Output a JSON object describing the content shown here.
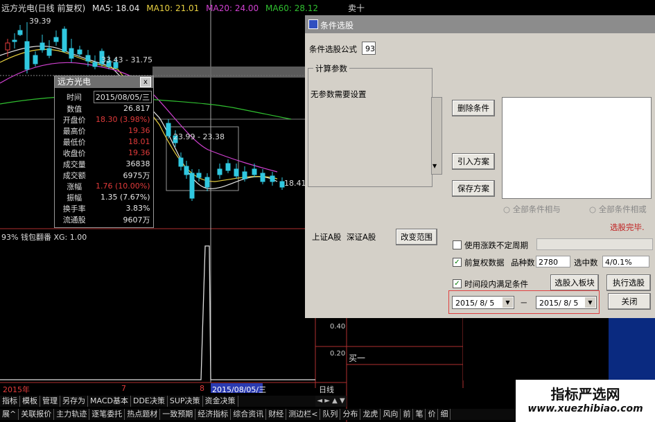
{
  "chart_header": {
    "title": "远方光电(日线 前复权)",
    "ma5": "MA5: 18.04",
    "ma10": "MA10: 21.01",
    "ma20": "MA20: 24.00",
    "ma60": "MA60: 28.12",
    "right_cut": "卖十"
  },
  "price_labels": {
    "high": "39.39",
    "range1": "33.43 - 31.75",
    "range2": "23.99 - 23.38",
    "right": "18.41"
  },
  "indicator": {
    "header": "93% 钱包翻番  XG: 1.00",
    "ticks": [
      "0.40",
      "0.20"
    ],
    "buy_label": "买一"
  },
  "x_axis": {
    "year": "2015年",
    "m7": "7",
    "m8": "8",
    "cursor_date": "2015/08/05/三",
    "period": "日线"
  },
  "info_popup": {
    "title": "远方光电",
    "close_glyph": "x",
    "rows": [
      {
        "k": "时间",
        "v": "2015/08/05/三",
        "c": "#e6e6e6"
      },
      {
        "k": "数值",
        "v": "26.817",
        "c": "#e6e6e6"
      },
      {
        "k": "开盘价",
        "v": "18.30 (3.98%)",
        "c": "#e23b3b"
      },
      {
        "k": "最高价",
        "v": "19.36",
        "c": "#e23b3b"
      },
      {
        "k": "最低价",
        "v": "18.01",
        "c": "#e23b3b"
      },
      {
        "k": "收盘价",
        "v": "19.36",
        "c": "#e23b3b"
      },
      {
        "k": "成交量",
        "v": "36838",
        "c": "#e6e6e6"
      },
      {
        "k": "成交额",
        "v": "6975万",
        "c": "#e6e6e6"
      },
      {
        "k": "涨幅",
        "v": "1.76 (10.00%)",
        "c": "#e23b3b"
      },
      {
        "k": "振幅",
        "v": "1.35 (7.67%)",
        "c": "#e6e6e6"
      },
      {
        "k": "换手率",
        "v": "3.83%",
        "c": "#e6e6e6"
      },
      {
        "k": "流通股",
        "v": "9607万",
        "c": "#e6e6e6"
      }
    ]
  },
  "dialog": {
    "title": "条件选股",
    "formula_label": "条件选股公式",
    "formula_value": "93",
    "group_label": "计算参数",
    "no_param": "无参数需要设置",
    "delete_btn": "删除条件",
    "import_btn": "引入方案",
    "save_btn": "保存方案",
    "radio_and": "全部条件相与",
    "radio_or": "全部条件相或",
    "done": "选股完毕.",
    "market1": "上证A股",
    "market2": "深证A股",
    "change_range": "改变范围",
    "cb_period": "使用涨跌不定周期",
    "cb_adjust": "前复权数据",
    "count_label": "品种数",
    "count_value": "2780",
    "selected_label": "选中数",
    "selected_value": "4/0.1%",
    "cb_range": "时间段内满足条件",
    "to_block": "选股入板块",
    "run": "执行选股",
    "date_from": "2015/ 8/ 5",
    "date_sep": "－",
    "date_to": "2015/ 8/ 5",
    "close": "关闭",
    "check_glyph": "✓",
    "arrow_glyph": "▼"
  },
  "tabs_row1": [
    "指标",
    "模板",
    "管理",
    "另存为",
    "MACD基本",
    "DDE决策",
    "SUP决策",
    "资金决策"
  ],
  "tabs_row2": [
    "展^",
    "关联报价",
    "主力轨迹",
    "逐笔委托",
    "热点题材",
    "一致预期",
    "经济指标",
    "综合资讯",
    "财经",
    "测边栏<",
    "队列",
    "分布",
    "龙虎",
    "风向",
    "前",
    "笔",
    "价",
    "细"
  ],
  "watermark": {
    "line1": "指标严选网",
    "line2": "www.xuezhibiao.com"
  },
  "colors": {
    "up": "#e23b3b",
    "down": "#30c8e0",
    "ma5": "#e8e8e8",
    "ma10": "#e8d040",
    "ma20": "#d040d0",
    "ma60": "#30c030"
  }
}
